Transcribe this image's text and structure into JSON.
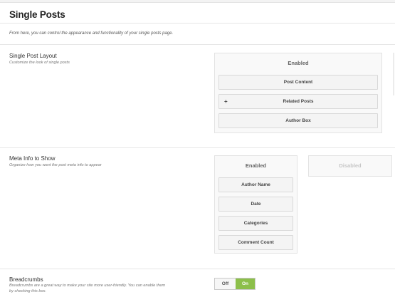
{
  "page": {
    "title": "Single Posts",
    "intro": "From here, you can control the appearance and functionality of your single posts page."
  },
  "layout_section": {
    "title": "Single Post Layout",
    "description": "Customize the look of single posts",
    "enabled_label": "Enabled",
    "items": [
      {
        "label": "Post Content"
      },
      {
        "label": "Related Posts",
        "prefix": "+"
      },
      {
        "label": "Author Box"
      }
    ]
  },
  "meta_section": {
    "title": "Meta Info to Show",
    "description": "Organize how you want the post meta info to appear",
    "enabled_label": "Enabled",
    "disabled_label": "Disabled",
    "items": [
      {
        "label": "Author Name"
      },
      {
        "label": "Date"
      },
      {
        "label": "Categories"
      },
      {
        "label": "Comment Count"
      }
    ]
  },
  "breadcrumbs_section": {
    "title": "Breadcrumbs",
    "description_line1": "Breadcrumbs are a great way to make your site more user-friendly. You can enable them",
    "description_line2": "by checking this box.",
    "toggle": {
      "off_label": "Off",
      "on_label": "On",
      "value": "On"
    }
  },
  "colors": {
    "accent_on": "#8cbf4a",
    "border": "#e3e3e3"
  }
}
